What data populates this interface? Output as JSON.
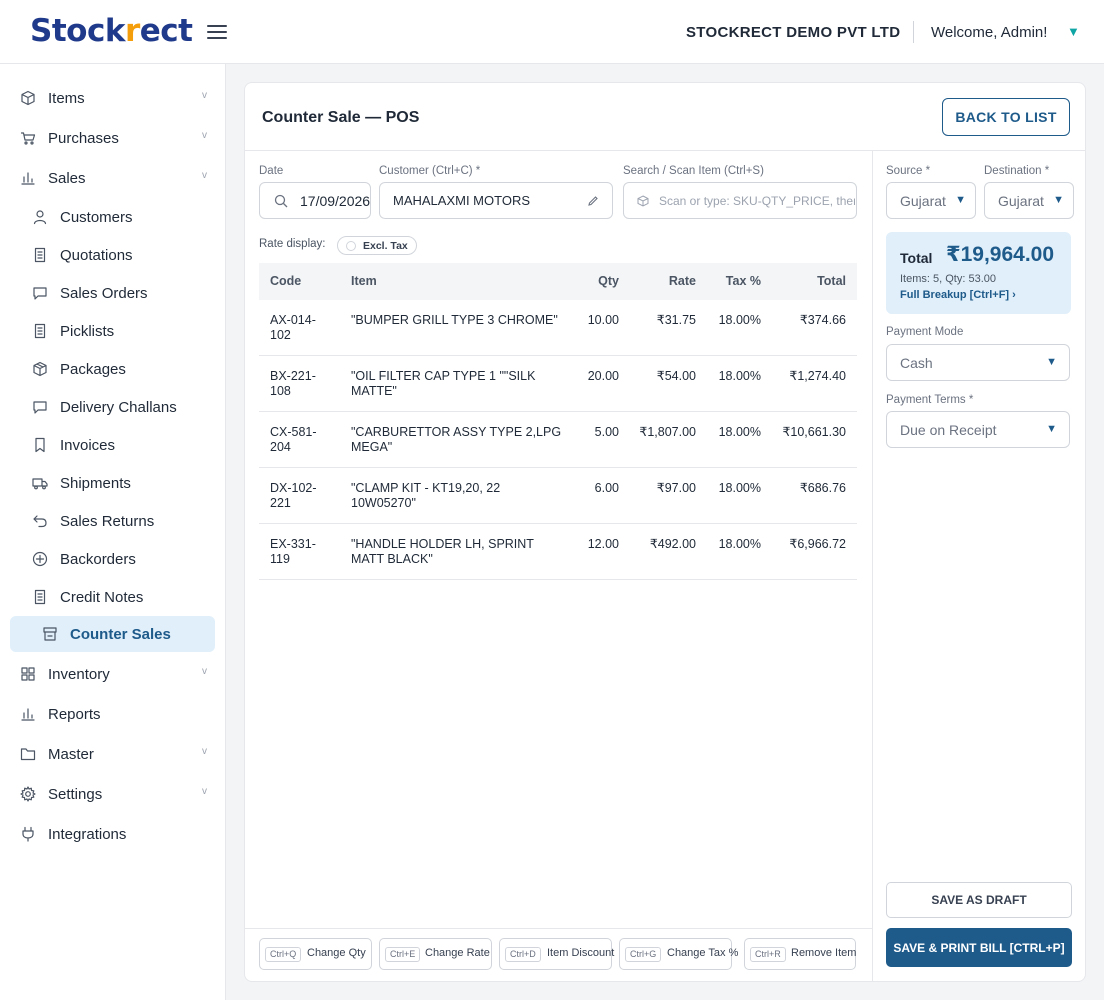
{
  "header": {
    "logo": {
      "prefix": "Stock",
      "mark": "r",
      "suffix": "ect"
    },
    "company": "STOCKRECT DEMO PVT LTD",
    "welcome": "Welcome, Admin!"
  },
  "sidebar": {
    "items": [
      {
        "label": "Items",
        "icon": "cube-icon",
        "chevron": true
      },
      {
        "label": "Purchases",
        "icon": "cart-icon",
        "chevron": true
      },
      {
        "label": "Sales",
        "icon": "bar-chart-icon",
        "chevron": true
      }
    ],
    "sales_sub": [
      {
        "label": "Customers",
        "icon": "user-icon"
      },
      {
        "label": "Quotations",
        "icon": "document-icon"
      },
      {
        "label": "Sales Orders",
        "icon": "chat-icon"
      },
      {
        "label": "Picklists",
        "icon": "document-icon"
      },
      {
        "label": "Packages",
        "icon": "package-icon"
      },
      {
        "label": "Delivery Challans",
        "icon": "chat-icon"
      },
      {
        "label": "Invoices",
        "icon": "bookmark-icon"
      },
      {
        "label": "Shipments",
        "icon": "truck-icon"
      },
      {
        "label": "Sales Returns",
        "icon": "return-icon"
      },
      {
        "label": "Backorders",
        "icon": "plus-circle-icon"
      },
      {
        "label": "Credit Notes",
        "icon": "document-icon"
      },
      {
        "label": "Counter Sales",
        "icon": "store-icon"
      }
    ],
    "bottom_items": [
      {
        "label": "Inventory",
        "icon": "grid-icon",
        "chevron": true
      },
      {
        "label": "Reports",
        "icon": "bar-chart-icon",
        "chevron": false
      },
      {
        "label": "Master",
        "icon": "folder-icon",
        "chevron": true
      },
      {
        "label": "Settings",
        "icon": "gear-icon",
        "chevron": true
      },
      {
        "label": "Integrations",
        "icon": "plug-icon",
        "chevron": false
      }
    ]
  },
  "page": {
    "title": "Counter Sale — POS",
    "back_label": "BACK TO LIST"
  },
  "form": {
    "date_label": "Date",
    "date_value": "17/09/2026",
    "customer_label": "Customer (Ctrl+C) *",
    "customer_value": "MAHALAXMI MOTORS",
    "search_label": "Search / Scan Item (Ctrl+S)",
    "search_placeholder": "Scan or type: SKU-QTY_PRICE, then Enter",
    "rate_display_label": "Rate display:",
    "rate_display_value": "Excl. Tax"
  },
  "table": {
    "columns": [
      "Code",
      "Item",
      "Qty",
      "Rate",
      "Tax %",
      "Total"
    ],
    "rows": [
      {
        "code": [
          "AX-014-",
          "102"
        ],
        "item": [
          "\"BUMPER GRILL TYPE 3 CHROME\"",
          ""
        ],
        "qty": "10.00",
        "rate": "₹31.75",
        "tax": "18.00%",
        "total": "₹374.66"
      },
      {
        "code": [
          "BX-221-",
          "108"
        ],
        "item": [
          "\"OIL FILTER CAP TYPE 1 \"\"SILK",
          "MATTE\""
        ],
        "qty": "20.00",
        "rate": "₹54.00",
        "tax": "18.00%",
        "total": "₹1,274.40"
      },
      {
        "code": [
          "CX-581-",
          "204"
        ],
        "item": [
          "\"CARBURETTOR ASSY TYPE 2,LPG",
          "MEGA\""
        ],
        "qty": "5.00",
        "rate": "₹1,807.00",
        "tax": "18.00%",
        "total": "₹10,661.30"
      },
      {
        "code": [
          "DX-102-",
          "221"
        ],
        "item": [
          "\"CLAMP KIT - KT19,20, 22",
          "10W05270\""
        ],
        "qty": "6.00",
        "rate": "₹97.00",
        "tax": "18.00%",
        "total": "₹686.76"
      },
      {
        "code": [
          "EX-331-",
          "119"
        ],
        "item": [
          "\"HANDLE HOLDER LH, SPRINT",
          "MATT BLACK\""
        ],
        "qty": "12.00",
        "rate": "₹492.00",
        "tax": "18.00%",
        "total": "₹6,966.72"
      }
    ]
  },
  "shortcuts": [
    {
      "key": "Ctrl+Q",
      "label": "Change Qty"
    },
    {
      "key": "Ctrl+E",
      "label": "Change Rate"
    },
    {
      "key": "Ctrl+D",
      "label": "Item Discount"
    },
    {
      "key": "Ctrl+G",
      "label": "Change Tax %"
    },
    {
      "key": "Ctrl+R",
      "label": "Remove Item"
    }
  ],
  "right_panel": {
    "source_label": "Source *",
    "source_value": "Gujarat",
    "destination_label": "Destination *",
    "destination_value": "Gujarat",
    "total_label": "Total",
    "total_value": "₹19,964.00",
    "total_meta": "Items: 5, Qty: 53.00",
    "breakup_label": "Full Breakup [Ctrl+F] ›",
    "payment_mode_label": "Payment Mode",
    "payment_mode_value": "Cash",
    "payment_terms_label": "Payment Terms *",
    "payment_terms_value": "Due on Receipt",
    "draft_label": "SAVE AS DRAFT",
    "print_label": "SAVE & PRINT BILL [CTRL+P]"
  },
  "colors": {
    "primary": "#1e5a8a",
    "brand": "#1f3a8a",
    "accent": "#f59e0b",
    "active_bg": "#e0effa"
  }
}
